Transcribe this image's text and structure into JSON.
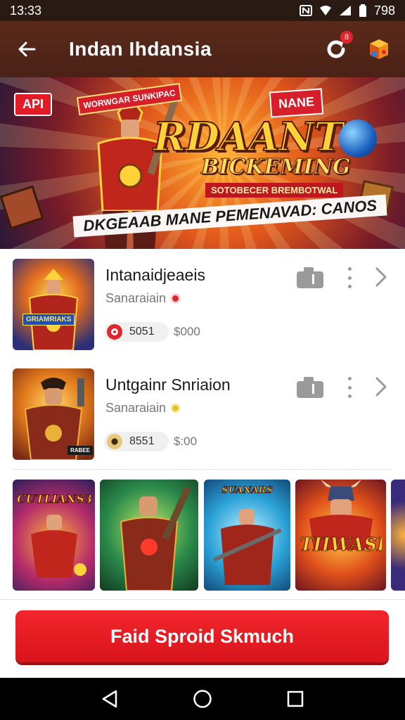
{
  "status_bar": {
    "time": "13:33",
    "battery": "798"
  },
  "app_bar": {
    "title": "Indan Ihdansia",
    "notification_badge": "8",
    "back_icon": "arrow-left-icon",
    "refresh_icon": "refresh-icon",
    "cube_icon": "game-cube-icon"
  },
  "banner": {
    "badge": "API",
    "tag_left": "WORWGAR SUNKIPAC",
    "tag_right": "NANE",
    "headline": "RDAANTS",
    "subheadline": "BICKEMING",
    "strip": "SOTOBECER BREMBOTWAL",
    "footer": "DKGEAAB MANE PEMENAVAD: CANOS"
  },
  "list": [
    {
      "title": "Intanaidjeaeis",
      "subtitle": "Sanaraiain",
      "sub_dot_color": "#e0262c",
      "pill_value": "5051",
      "pill_icon_color": "#e0262c",
      "price": "$000",
      "thumb_label": "GRIAMRIAKS"
    },
    {
      "title": "Untgainr Snriaion",
      "subtitle": "Sanaraiain",
      "sub_dot_color": "#e8c21f",
      "pill_value": "8551",
      "pill_icon_color": "#b08a3a",
      "price": "$:00",
      "thumb_label": "RABEE"
    }
  ],
  "carousel": [
    {
      "caption": "CUTLIANS3"
    },
    {
      "caption": ""
    },
    {
      "caption": "SUANARS"
    },
    {
      "caption": "TIIWASE"
    },
    {
      "caption": ""
    }
  ],
  "cta": {
    "label": "Faid Sproid Skmuch"
  },
  "colors": {
    "accent_red": "#e21c26",
    "app_bar_brown": "#4a2216"
  }
}
